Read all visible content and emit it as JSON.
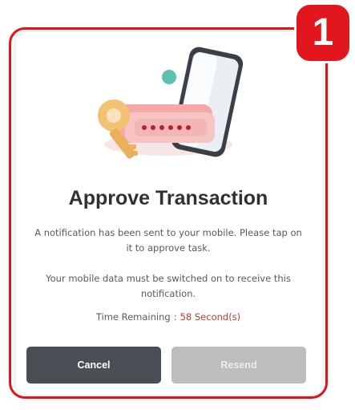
{
  "step_badge": "1",
  "dialog": {
    "title": "Approve Transaction",
    "message": "A notification has been sent to your mobile. Please tap on it to approve task.",
    "note": "Your mobile data must be switched on to receive this notification.",
    "timer_label": "Time Remaining",
    "timer_separator": ":",
    "timer_value": "58 Second(s)"
  },
  "buttons": {
    "cancel": "Cancel",
    "resend": "Resend"
  },
  "illustration": {
    "password_mask": "••••••"
  },
  "colors": {
    "accent_red": "#e2161f",
    "cancel_bg": "#4a4f55",
    "resend_bg": "#bcbdbe",
    "timer_value": "#c0392b"
  }
}
